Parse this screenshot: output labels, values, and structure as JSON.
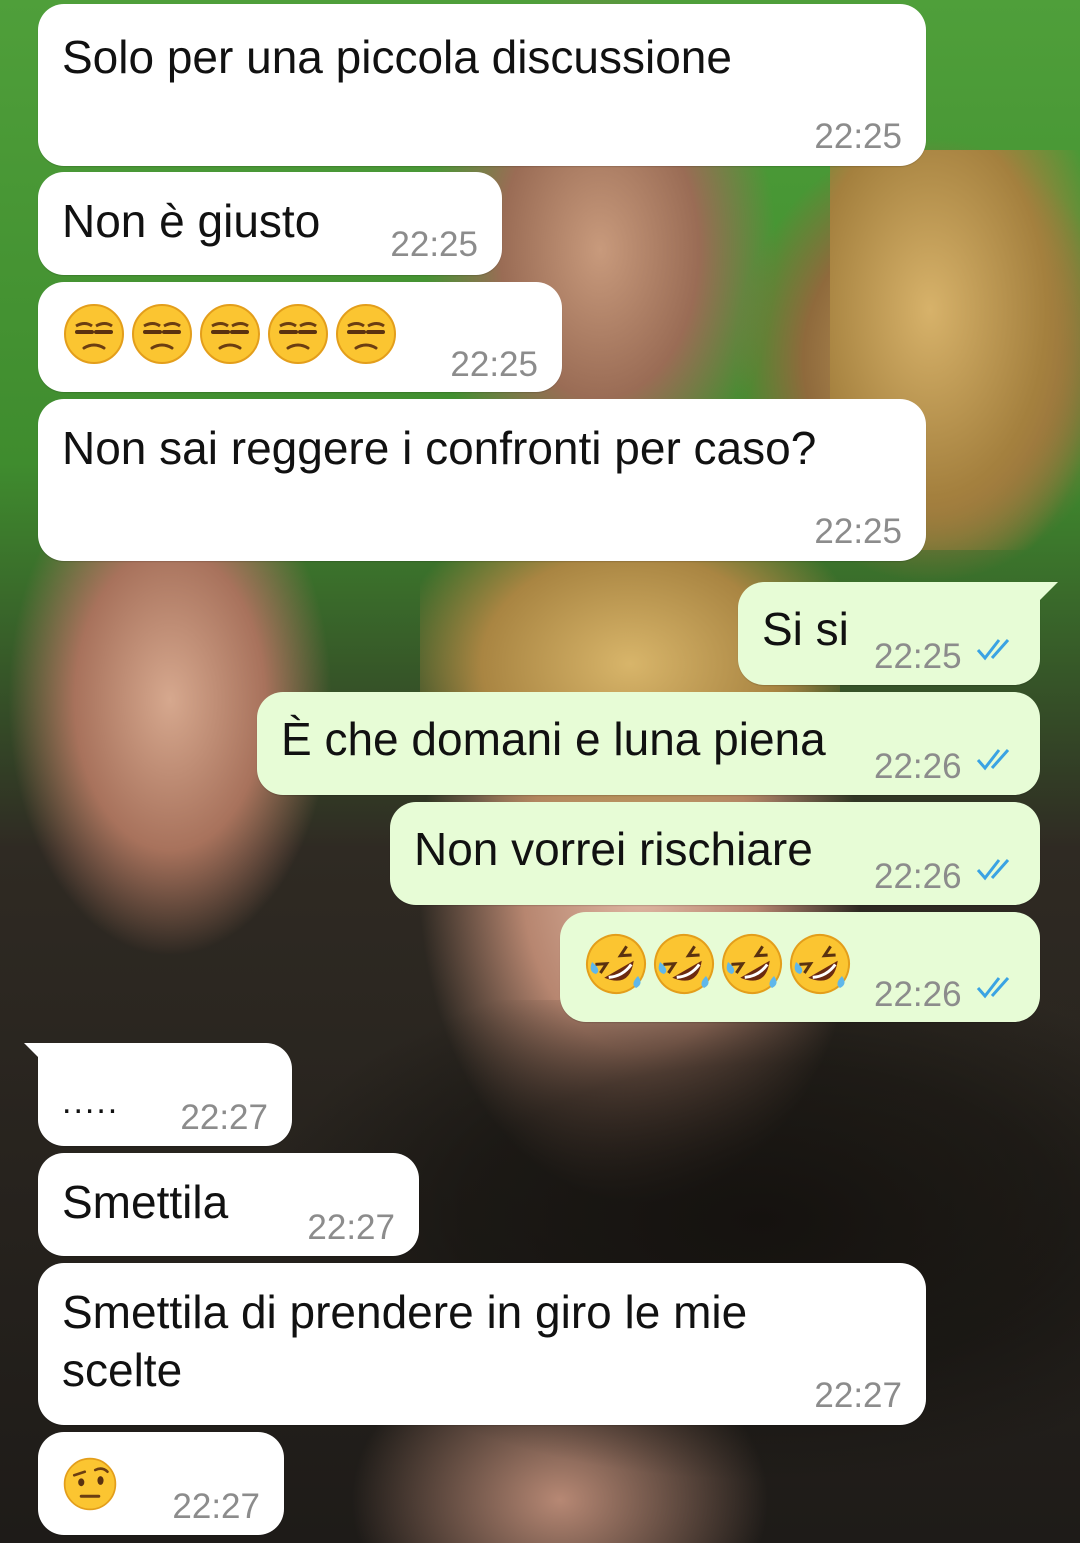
{
  "messages": [
    {
      "id": "m1",
      "side": "in",
      "text": "Solo per una piccola discussione",
      "time": "22:25"
    },
    {
      "id": "m2",
      "side": "in",
      "text": "Non è giusto",
      "time": "22:25"
    },
    {
      "id": "m3",
      "side": "in",
      "emoji": "unamused-face",
      "emoji_count": 5,
      "time": "22:25"
    },
    {
      "id": "m4",
      "side": "in",
      "text": "Non sai reggere i confronti per caso?",
      "time": "22:25"
    },
    {
      "id": "m5",
      "side": "out",
      "text": "Si si",
      "time": "22:25",
      "status": "read"
    },
    {
      "id": "m6",
      "side": "out",
      "text": "È che domani e luna piena",
      "time": "22:26",
      "status": "read"
    },
    {
      "id": "m7",
      "side": "out",
      "text": "Non vorrei rischiare",
      "time": "22:26",
      "status": "read"
    },
    {
      "id": "m8",
      "side": "out",
      "emoji": "rolling-on-floor-laughing",
      "emoji_count": 4,
      "time": "22:26",
      "status": "read"
    },
    {
      "id": "m9",
      "side": "in",
      "text": ".....",
      "time": "22:27"
    },
    {
      "id": "m10",
      "side": "in",
      "text": "Smettila",
      "time": "22:27"
    },
    {
      "id": "m11",
      "side": "in",
      "text_line1": "Smettila di prendere in giro le mie",
      "text_line2": "scelte",
      "time": "22:27"
    },
    {
      "id": "m12",
      "side": "in",
      "emoji": "face-with-raised-eyebrow",
      "emoji_count": 1,
      "time": "22:27"
    }
  ],
  "colors": {
    "incoming_bubble": "#ffffff",
    "outgoing_bubble": "#e7fcd6",
    "timestamp": "#8c8c8c",
    "read_ticks": "#3aa3e3"
  }
}
